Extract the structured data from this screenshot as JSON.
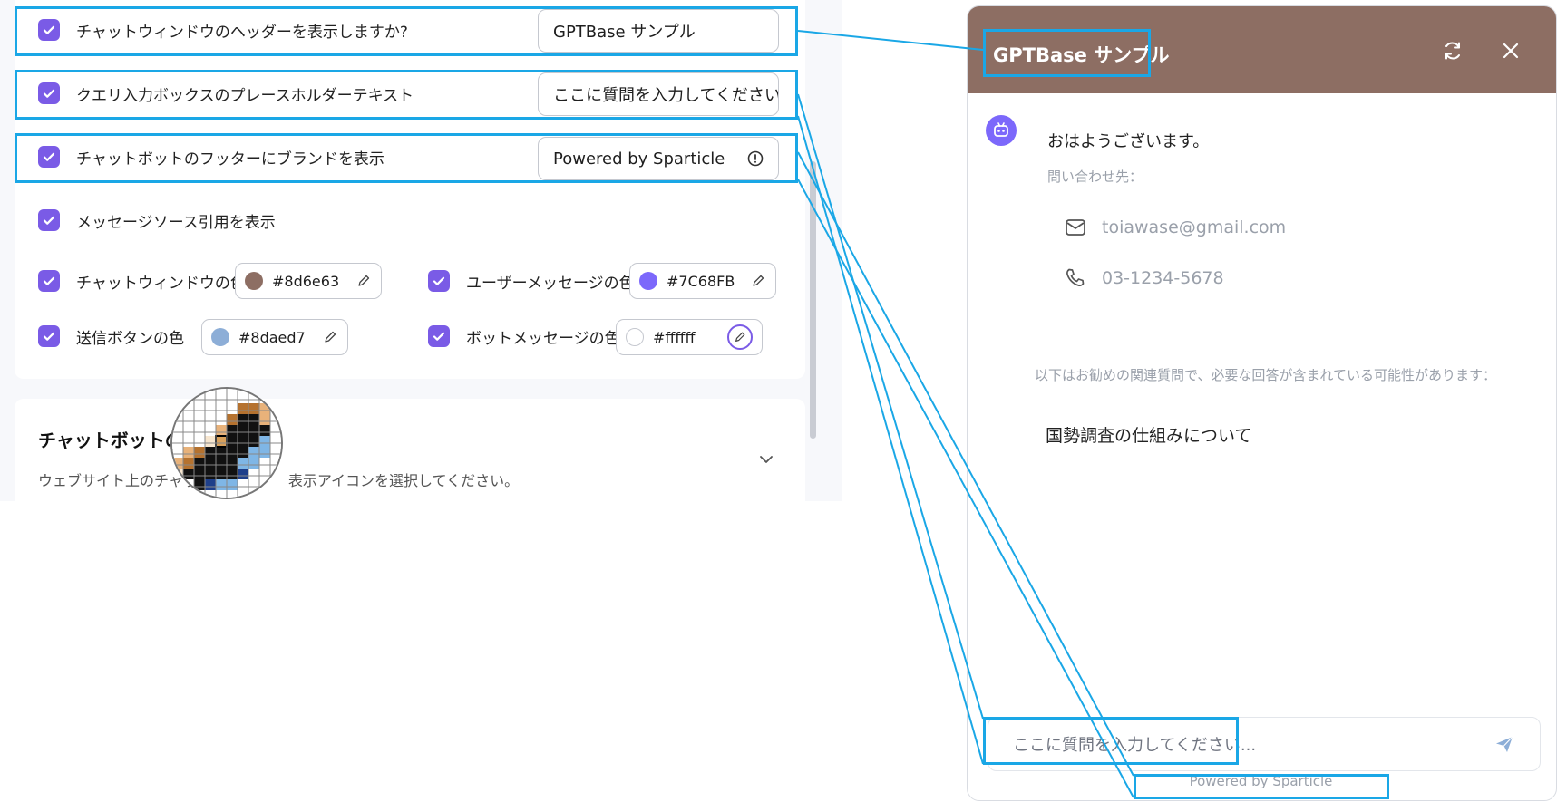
{
  "settings": {
    "rows": [
      {
        "label": "チャットウィンドウのヘッダーを表示しますか?",
        "value": "GPTBase サンプル"
      },
      {
        "label": "クエリ入力ボックスのプレースホルダーテキスト",
        "value": "ここに質問を入力してください..."
      },
      {
        "label": "チャットボットのフッターにブランドを表示",
        "value": "Powered by Sparticle"
      },
      {
        "label": "メッセージソース引用を表示"
      }
    ],
    "colors": [
      {
        "label": "チャットウィンドウの色",
        "value": "#8d6e63",
        "swatch": "#8d6e63"
      },
      {
        "label": "ユーザーメッセージの色",
        "value": "#7C68FB",
        "swatch": "#7c68fb"
      },
      {
        "label": "送信ボタンの色",
        "value": "#8daed7",
        "swatch": "#8daed7"
      },
      {
        "label": "ボットメッセージの色",
        "value": "#ffffff",
        "swatch": "#ffffff"
      }
    ],
    "section": {
      "title": "チャットボットの",
      "description": "ウェブサイト上のチャット",
      "description_end": "表示アイコンを選択してください。"
    },
    "accent": "#7a5be6"
  },
  "chat": {
    "title": "GPTBase サンプル",
    "header_color": "#8d6e63",
    "greeting": "おはようございます。",
    "contact_label": "問い合わせ先：",
    "email": "toiawase@gmail.com",
    "phone": "03-1234-5678",
    "recommend_note": "以下はお勧めの関連質問で、必要な回答が含まれている可能性があります：",
    "question": "国勢調査の仕組みについて",
    "input_placeholder": "ここに質問を入力してください...",
    "powered_by": "Powered by Sparticle"
  },
  "highlight_color": "#1aa7e6"
}
